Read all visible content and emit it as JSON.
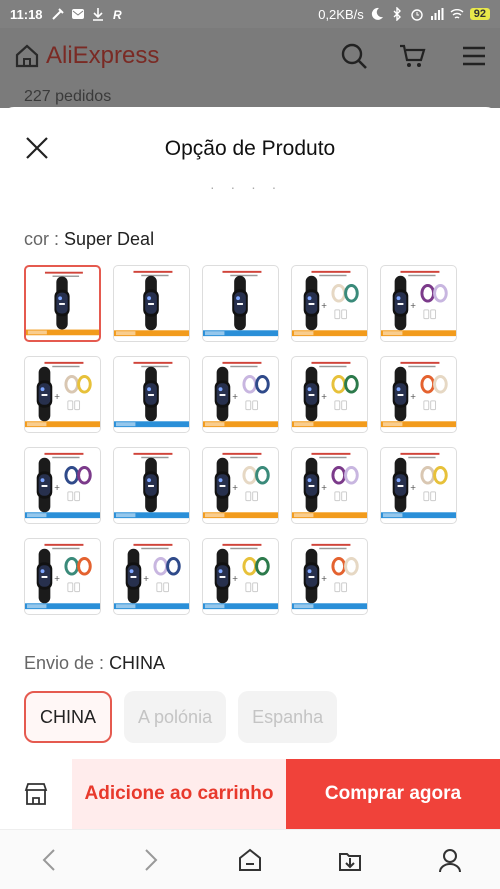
{
  "status_bar": {
    "time": "11:18",
    "network_speed": "0,2KB/s",
    "battery": "92"
  },
  "header": {
    "logo_text": "AliExpress",
    "orders": "227 pedidos"
  },
  "sheet": {
    "title": "Opção de Produto",
    "color_label": "cor : ",
    "color_value": "Super Deal",
    "variant_count": 19,
    "selected_index": 0,
    "ship_label": "Envio de : ",
    "ship_value": "CHINA",
    "ship_options": [
      "CHINA",
      "A polónia",
      "Espanha"
    ]
  },
  "actions": {
    "add_to_cart": "Adicione ao carrinho",
    "buy_now": "Comprar agora"
  },
  "colors": {
    "accent": "#f0423a",
    "accent_text": "#e8392c",
    "accent_light": "#ffecec"
  }
}
